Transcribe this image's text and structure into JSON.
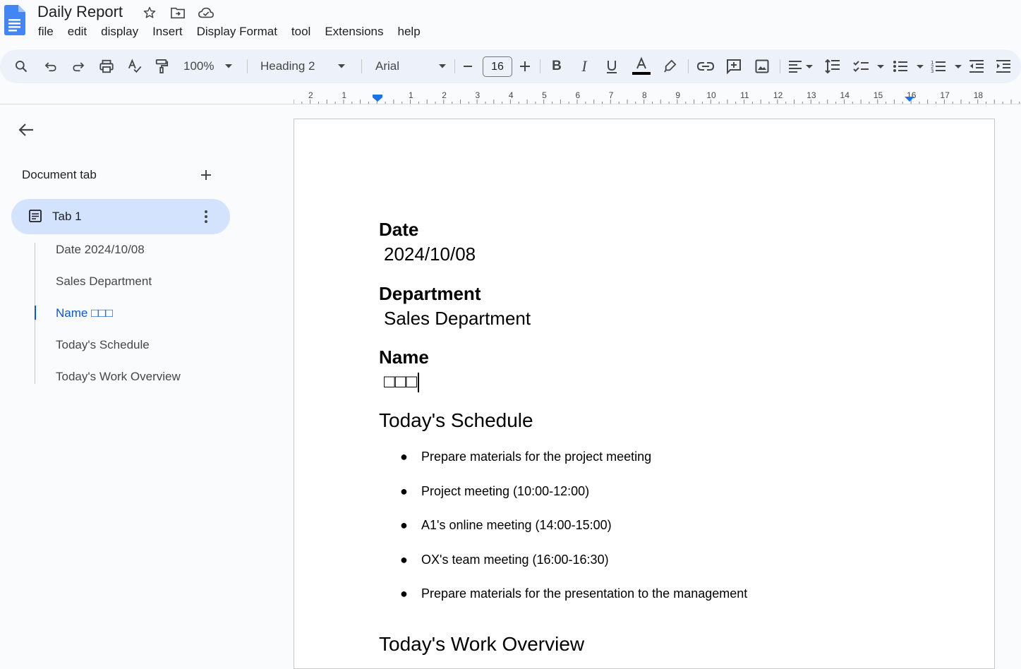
{
  "app": {
    "title": "Daily Report",
    "brand_color": "#4285f4"
  },
  "menu": [
    "file",
    "edit",
    "display",
    "Insert",
    "Display Format",
    "tool",
    "Extensions",
    "help"
  ],
  "toolbar": {
    "zoom": "100%",
    "style": "Heading 2",
    "font": "Arial",
    "font_size": "16",
    "icons": [
      "search-icon",
      "undo-icon",
      "redo-icon",
      "print-icon",
      "spellcheck-icon",
      "paint-format-icon",
      "bold-icon",
      "italic-icon",
      "underline-icon",
      "text-color-icon",
      "highlight-icon",
      "link-icon",
      "comment-icon",
      "image-icon",
      "align-icon",
      "line-spacing-icon",
      "checklist-icon",
      "bullet-list-icon",
      "numbered-list-icon",
      "decrease-indent-icon",
      "increase-indent-icon"
    ]
  },
  "ruler": {
    "labels": [
      "2",
      "1",
      "1",
      "2",
      "3",
      "4",
      "5",
      "6",
      "7",
      "8",
      "9",
      "10",
      "11",
      "12",
      "13",
      "14",
      "15",
      "16",
      "17",
      "18"
    ]
  },
  "sidebar": {
    "header": "Document tab",
    "tab_label": "Tab 1",
    "outline": [
      {
        "label": "Date 2024/10/08",
        "active": false
      },
      {
        "label": "Sales Department",
        "active": false
      },
      {
        "label": "Name □□□",
        "active": true
      },
      {
        "label": "Today's Schedule",
        "active": false
      },
      {
        "label": "Today's Work Overview",
        "active": false
      }
    ]
  },
  "document": {
    "date_label": "Date",
    "date_value": "2024/10/08",
    "department_label": "Department",
    "department_value": "Sales Department",
    "name_label": "Name",
    "name_value": "□□□",
    "schedule_heading": "Today's Schedule",
    "schedule_items": [
      "Prepare materials for the project meeting",
      "Project meeting (10:00-12:00)",
      "A1's online meeting (14:00-15:00)",
      "OX's team meeting (16:00-16:30)",
      "Prepare materials for the presentation to the management"
    ],
    "overview_heading": "Today's Work Overview"
  }
}
